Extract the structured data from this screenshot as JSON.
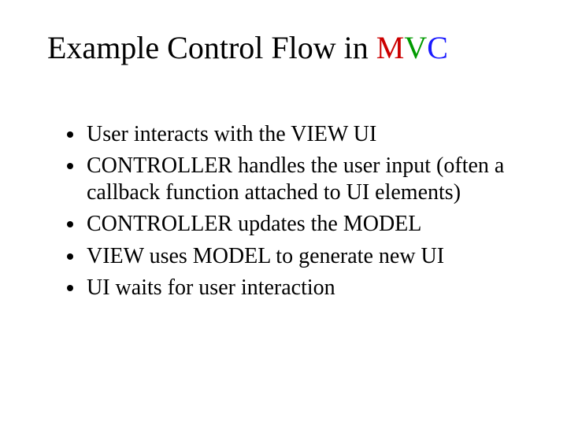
{
  "title": {
    "prefix": "Example Control Flow in ",
    "m": "M",
    "v": "V",
    "c": "C"
  },
  "bullets": [
    "User interacts with the VIEW UI",
    "CONTROLLER handles the user input (often a callback function attached to UI elements)",
    "CONTROLLER updates the MODEL",
    "VIEW uses MODEL to generate new UI",
    "UI waits for user interaction"
  ]
}
